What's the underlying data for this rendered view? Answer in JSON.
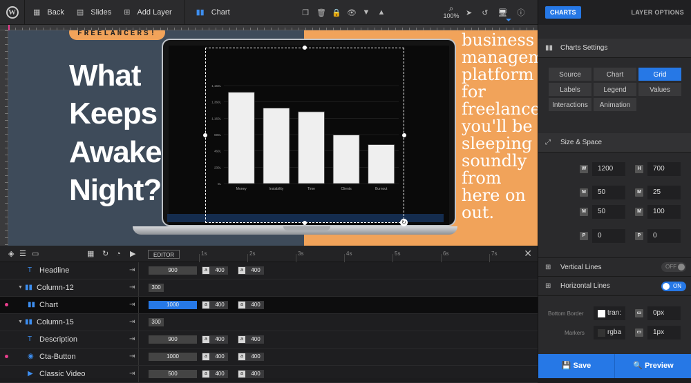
{
  "toolbar": {
    "back_label": "Back",
    "slides_label": "Slides",
    "add_layer_label": "Add Layer",
    "chart_label": "Chart",
    "zoom": "100%"
  },
  "stage": {
    "badge": "FREELANCERS!",
    "headline": "What Keeps You Awake At Night?",
    "right_text": "business management platform for freelancers you'll be sleeping soundly from here on out."
  },
  "chart_data": {
    "type": "bar",
    "categories": [
      "Money",
      "Instability",
      "Time",
      "Clients",
      "Burnout"
    ],
    "values": [
      1500,
      1240,
      1180,
      798,
      640
    ],
    "yticks": [
      "1,150L",
      "1,360L",
      "1,160L",
      "690L",
      "460L",
      "230L",
      "0L"
    ],
    "ylim": [
      0,
      1610
    ],
    "grid": true
  },
  "timeline": {
    "editor_tag": "EDITOR",
    "ticks": [
      "1s",
      "2s",
      "3s",
      "4s",
      "5s",
      "6s",
      "7s"
    ],
    "layers": [
      {
        "name": "Headline",
        "icon": "T",
        "start": "900",
        "a": "400",
        "b": "400"
      },
      {
        "name": "Column-12",
        "icon": "col",
        "start": "300"
      },
      {
        "name": "Chart",
        "icon": "chart",
        "start": "1000",
        "a": "400",
        "b": "400"
      },
      {
        "name": "Column-15",
        "icon": "col",
        "start": "300"
      },
      {
        "name": "Description",
        "icon": "T",
        "start": "900",
        "a": "400",
        "b": "400"
      },
      {
        "name": "Cta-Button",
        "icon": "btn",
        "start": "1000",
        "a": "400",
        "b": "400"
      },
      {
        "name": "Classic Video",
        "icon": "vid",
        "start": "500",
        "a": "400",
        "b": "400"
      }
    ]
  },
  "panel": {
    "tab_charts": "CHARTS",
    "tab_layer_options": "LAYER OPTIONS",
    "charts_settings": "Charts Settings",
    "tabs": [
      "Source",
      "Chart",
      "Grid",
      "Labels",
      "Legend",
      "Values",
      "Interactions",
      "Animation"
    ],
    "active_tab": "Grid",
    "size_space": "Size & Space",
    "width_label": "W",
    "width": "1200",
    "height_label": "H",
    "height": "700",
    "margin_label": "M",
    "m_top": "50",
    "m_right": "25",
    "m_bottom": "50",
    "m_left": "100",
    "padding_label": "P",
    "p_left": "0",
    "p_right": "0",
    "vertical_lines": "Vertical Lines",
    "vertical_state": "OFF",
    "horizontal_lines": "Horizontal Lines",
    "horizontal_state": "ON",
    "bottom_border_label": "Bottom Border",
    "bottom_border_color": "tran:",
    "bottom_border_px": "0px",
    "markers_label": "Markers",
    "markers_color": "rgba",
    "markers_px": "1px",
    "save_label": "Save",
    "preview_label": "Preview"
  },
  "colors": {
    "accent": "#2678e6",
    "stage_left": "#3e4b5a",
    "stage_right": "#f1a35a",
    "marker": "#e83e8c"
  }
}
